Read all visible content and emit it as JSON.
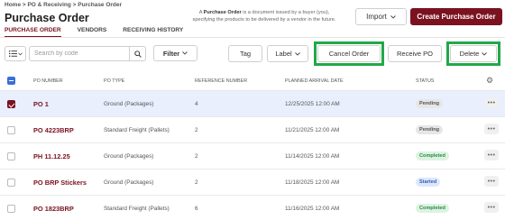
{
  "breadcrumb": "Home > PO & Receiving > Purchase Order",
  "page_title": "Purchase Order",
  "description": {
    "prefix": "A ",
    "bold": "Purchase Order",
    "suffix": " is a document issued by a buyer (you), specifying the products to be delivered by a vendor in the future."
  },
  "header_buttons": {
    "import_label": "Import",
    "create_label": "Create Purchase Order"
  },
  "tabs": [
    {
      "label": "PURCHASE ORDER",
      "active": true
    },
    {
      "label": "VENDORS",
      "active": false
    },
    {
      "label": "RECEIVING HISTORY",
      "active": false
    }
  ],
  "toolbar": {
    "search_placeholder": "Search by code",
    "filter_label": "Filter",
    "tag_label": "Tag",
    "label_label": "Label",
    "cancel_label": "Cancel Order",
    "receive_label": "Receive PO",
    "delete_label": "Delete"
  },
  "table": {
    "columns": [
      "PO NUMBER",
      "PO TYPE",
      "REFERENCE NUMBER",
      "PLANNED ARRIVAL DATE",
      "STATUS"
    ],
    "rows": [
      {
        "po": "PO 1",
        "type": "Ground (Packages)",
        "ref": "4",
        "date": "12/25/2025 12:00 AM",
        "status": "Pending",
        "selected": true
      },
      {
        "po": "PO 4223BRP",
        "type": "Standard Freight (Pallets)",
        "ref": "2",
        "date": "11/21/2025 12:00 AM",
        "status": "Pending",
        "selected": false
      },
      {
        "po": "PH 11.12.25",
        "type": "Ground (Packages)",
        "ref": "2",
        "date": "11/14/2025 12:00 AM",
        "status": "Completed",
        "selected": false
      },
      {
        "po": "PO BRP Stickers",
        "type": "Ground (Packages)",
        "ref": "2",
        "date": "11/18/2025 12:00 AM",
        "status": "Started",
        "selected": false
      },
      {
        "po": "PO 1823BRP",
        "type": "Standard Freight (Pallets)",
        "ref": "6",
        "date": "11/16/2025 12:00 AM",
        "status": "Completed",
        "selected": false
      }
    ]
  },
  "colors": {
    "brand": "#7a1220",
    "highlight": "#21a84a",
    "selected_row": "#e9effd"
  }
}
